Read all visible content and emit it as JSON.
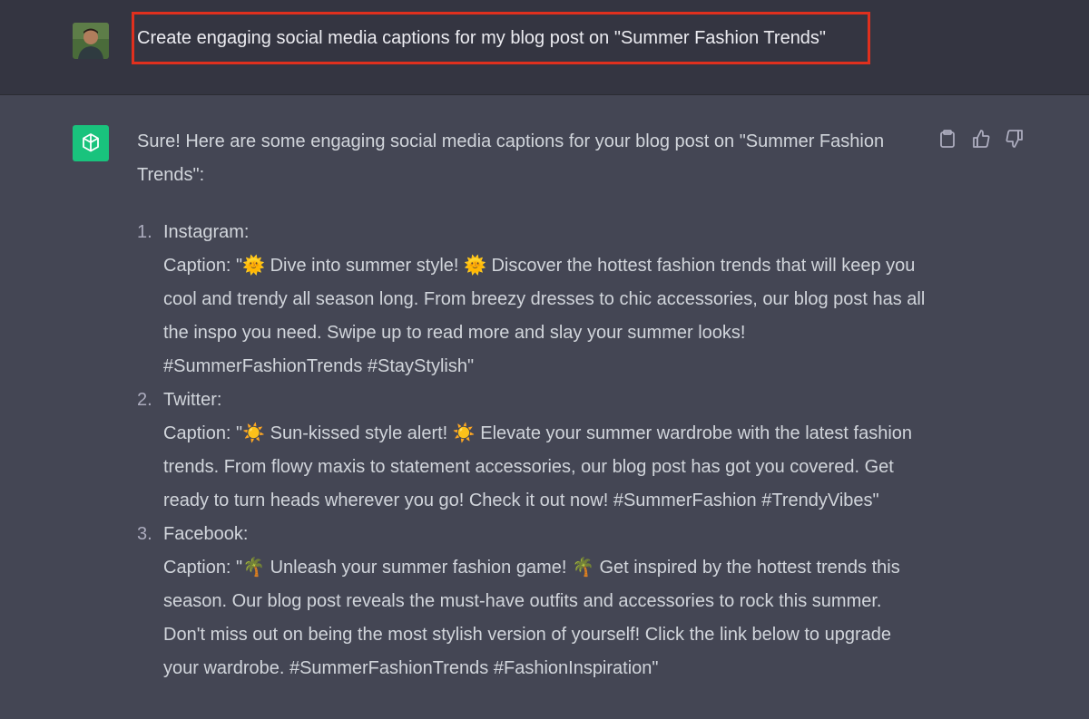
{
  "user_message": {
    "avatar": "user-avatar-photo",
    "text": "Create engaging social media captions for my blog post on \"Summer Fashion Trends\""
  },
  "assistant_message": {
    "avatar": "openai-logo-icon",
    "intro": "Sure! Here are some engaging social media captions for your blog post on \"Summer Fashion Trends\":",
    "items": [
      {
        "number": "1.",
        "platform": "Instagram:",
        "caption": "Caption: \"🌞 Dive into summer style! 🌞 Discover the hottest fashion trends that will keep you cool and trendy all season long. From breezy dresses to chic accessories, our blog post has all the inspo you need. Swipe up to read more and slay your summer looks! #SummerFashionTrends #StayStylish\""
      },
      {
        "number": "2.",
        "platform": "Twitter:",
        "caption": "Caption: \"☀️ Sun-kissed style alert! ☀️ Elevate your summer wardrobe with the latest fashion trends. From flowy maxis to statement accessories, our blog post has got you covered. Get ready to turn heads wherever you go! Check it out now! #SummerFashion #TrendyVibes\""
      },
      {
        "number": "3.",
        "platform": "Facebook:",
        "caption": "Caption: \"🌴 Unleash your summer fashion game! 🌴 Get inspired by the hottest trends this season. Our blog post reveals the must-have outfits and accessories to rock this summer. Don't miss out on being the most stylish version of yourself! Click the link below to upgrade your wardrobe. #SummerFashionTrends #FashionInspiration\""
      }
    ],
    "actions": [
      "copy-icon",
      "thumbs-up-icon",
      "thumbs-down-icon"
    ]
  },
  "colors": {
    "user_bg": "#343541",
    "assistant_bg": "#444654",
    "highlight_border": "#e0301e",
    "bot_avatar": "#19c37d"
  }
}
